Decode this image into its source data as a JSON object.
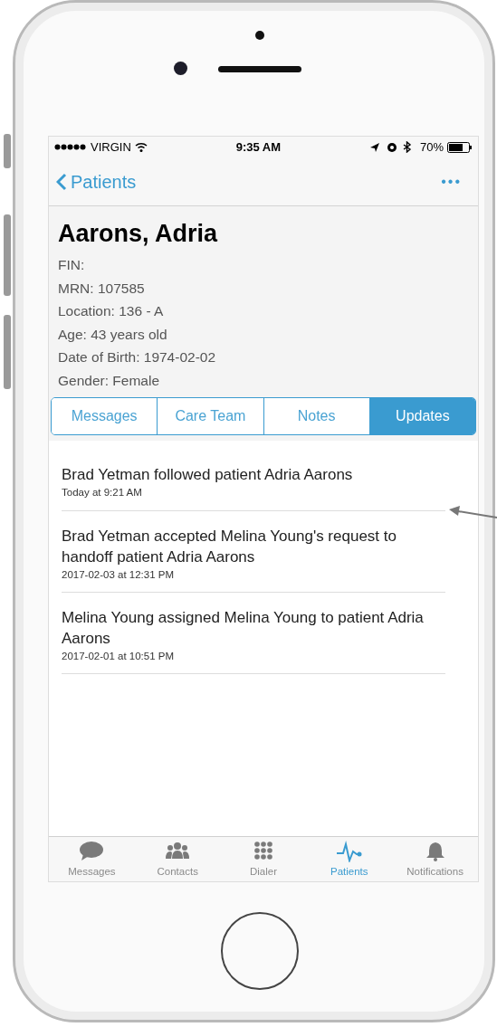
{
  "status_bar": {
    "carrier": "VIRGIN",
    "time": "9:35 AM",
    "battery": "70%"
  },
  "nav": {
    "back": "Patients",
    "more": "•••"
  },
  "patient": {
    "name": "Aarons, Adria",
    "fields": [
      "FIN:",
      "MRN: 107585",
      "Location: 136 - A",
      "Age: 43 years old",
      "Date of Birth: 1974-02-02",
      "Gender: Female"
    ]
  },
  "tabs": [
    {
      "label": "Messages",
      "selected": false
    },
    {
      "label": "Care Team",
      "selected": false
    },
    {
      "label": "Notes",
      "selected": false
    },
    {
      "label": "Updates",
      "selected": true
    }
  ],
  "updates": [
    {
      "text": "Brad Yetman followed patient Adria Aarons",
      "time": "Today at 9:21 AM"
    },
    {
      "text": "Brad Yetman accepted Melina Young's request to handoff patient Adria Aarons",
      "time": "2017-02-03 at 12:31 PM"
    },
    {
      "text": "Melina Young assigned Melina Young to patient Adria Aarons",
      "time": "2017-02-01 at 10:51 PM"
    }
  ],
  "tab_bar": [
    {
      "kind": "chat",
      "label": "Messages",
      "selected": false
    },
    {
      "kind": "people",
      "label": "Contacts",
      "selected": false
    },
    {
      "kind": "keypad",
      "label": "Dialer",
      "selected": false
    },
    {
      "kind": "pulse",
      "label": "Patients",
      "selected": true
    },
    {
      "kind": "bell",
      "label": "Notifications",
      "selected": false
    }
  ]
}
